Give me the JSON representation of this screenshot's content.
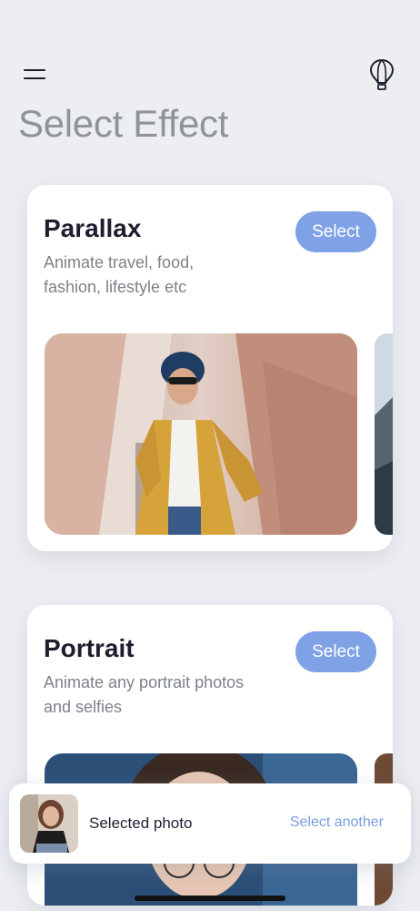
{
  "header": {
    "menu_icon": "hamburger-menu-icon",
    "balloon_icon": "hot-air-balloon-icon",
    "title": "Select Effect"
  },
  "effects": [
    {
      "title": "Parallax",
      "description": "Animate travel, food, fashion, lifestyle etc",
      "select_label": "Select"
    },
    {
      "title": "Portrait",
      "description": "Animate any portrait photos and selfies",
      "select_label": "Select"
    }
  ],
  "selected_bar": {
    "label": "Selected photo",
    "action_label": "Select another"
  },
  "colors": {
    "background": "#eceef2",
    "accent": "#7fa2e6",
    "title_gray": "#8f949c",
    "text_dark": "#1d1f2e"
  }
}
